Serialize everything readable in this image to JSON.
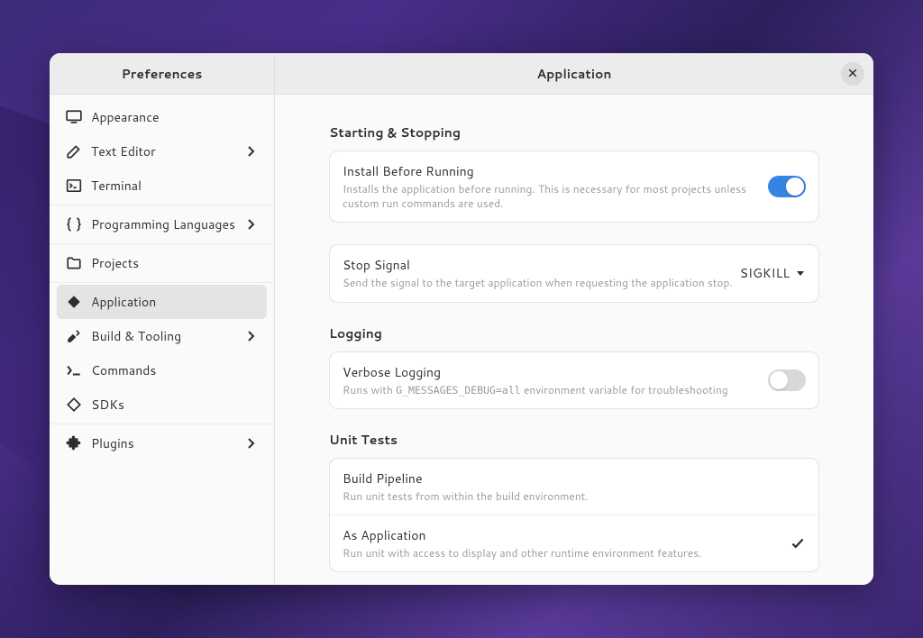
{
  "sidebar": {
    "title": "Preferences",
    "groups": [
      {
        "items": [
          {
            "key": "appearance",
            "label": "Appearance",
            "icon": "monitor",
            "expandable": false
          },
          {
            "key": "text-editor",
            "label": "Text Editor",
            "icon": "pencil",
            "expandable": true
          },
          {
            "key": "terminal",
            "label": "Terminal",
            "icon": "terminal",
            "expandable": false
          }
        ]
      },
      {
        "items": [
          {
            "key": "programming-languages",
            "label": "Programming Languages",
            "icon": "braces",
            "expandable": true
          }
        ]
      },
      {
        "items": [
          {
            "key": "projects",
            "label": "Projects",
            "icon": "folder",
            "expandable": false
          }
        ]
      },
      {
        "items": [
          {
            "key": "application",
            "label": "Application",
            "icon": "diamond",
            "expandable": false,
            "selected": true
          },
          {
            "key": "build-tooling",
            "label": "Build & Tooling",
            "icon": "tools",
            "expandable": true
          },
          {
            "key": "commands",
            "label": "Commands",
            "icon": "prompt",
            "expandable": false
          },
          {
            "key": "sdks",
            "label": "SDKs",
            "icon": "diamond-outline",
            "expandable": false
          }
        ]
      },
      {
        "items": [
          {
            "key": "plugins",
            "label": "Plugins",
            "icon": "puzzle",
            "expandable": true
          }
        ]
      }
    ]
  },
  "main": {
    "title": "Application",
    "sections": {
      "starting_stopping": {
        "title": "Starting & Stopping",
        "install_before_running": {
          "title": "Install Before Running",
          "desc": "Installs the application before running. This is necessary for most projects unless custom run commands are used.",
          "enabled": true
        },
        "stop_signal": {
          "title": "Stop Signal",
          "desc": "Send the signal to the target application when requesting the application stop.",
          "value": "SIGKILL"
        }
      },
      "logging": {
        "title": "Logging",
        "verbose": {
          "title": "Verbose Logging",
          "desc_pre": "Runs with ",
          "desc_code": "G_MESSAGES_DEBUG=all",
          "desc_post": " environment variable for troubleshooting",
          "enabled": false
        }
      },
      "unit_tests": {
        "title": "Unit Tests",
        "build_pipeline": {
          "title": "Build Pipeline",
          "desc": "Run unit tests from within the build environment.",
          "selected": false
        },
        "as_application": {
          "title": "As Application",
          "desc": "Run unit with access to display and other runtime environment features.",
          "selected": true
        }
      }
    }
  }
}
